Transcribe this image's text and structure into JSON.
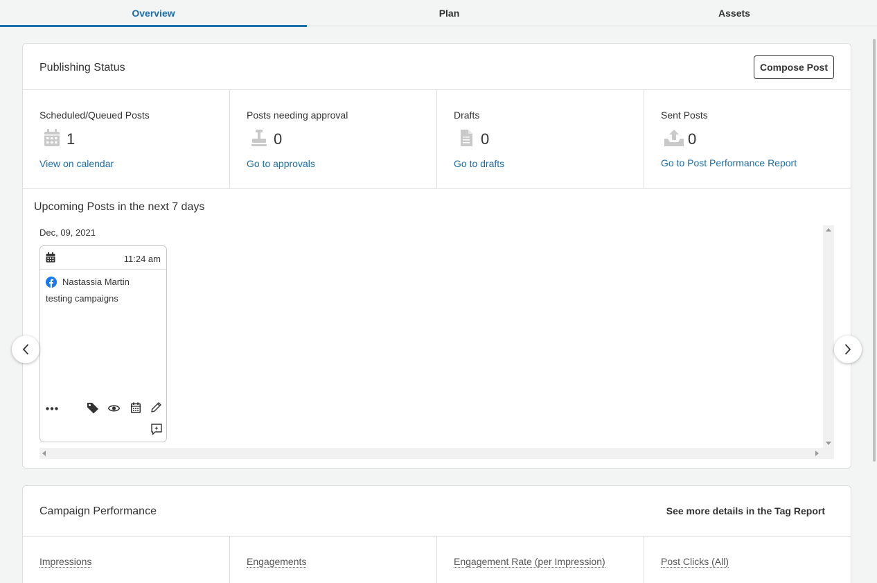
{
  "tabs": [
    {
      "label": "Overview",
      "active": true
    },
    {
      "label": "Plan",
      "active": false
    },
    {
      "label": "Assets",
      "active": false
    }
  ],
  "publishing": {
    "title": "Publishing Status",
    "compose_label": "Compose Post",
    "stats": [
      {
        "label": "Scheduled/Queued Posts",
        "value": "1",
        "link": "View on calendar",
        "icon": "calendar-icon"
      },
      {
        "label": "Posts needing approval",
        "value": "0",
        "link": "Go to approvals",
        "icon": "stamp-icon"
      },
      {
        "label": "Drafts",
        "value": "0",
        "link": "Go to drafts",
        "icon": "document-icon"
      },
      {
        "label": "Sent Posts",
        "value": "0",
        "link": "Go to Post Performance Report",
        "icon": "outbox-icon"
      }
    ],
    "upcoming_title": "Upcoming Posts in the next 7 days",
    "date_label": "Dec, 09, 2021",
    "post": {
      "time": "11:24 am",
      "author": "Nastassia Martin",
      "text": "testing campaigns",
      "network_icon": "facebook-icon"
    }
  },
  "campaign": {
    "title": "Campaign Performance",
    "tag_report_label": "See more details in the Tag Report",
    "metrics": [
      "Impressions",
      "Engagements",
      "Engagement Rate (per Impression)",
      "Post Clicks (All)"
    ]
  },
  "colors": {
    "accent": "#1b6ea8",
    "facebook": "#1877f2",
    "icon_gray": "#c9c9c9"
  }
}
